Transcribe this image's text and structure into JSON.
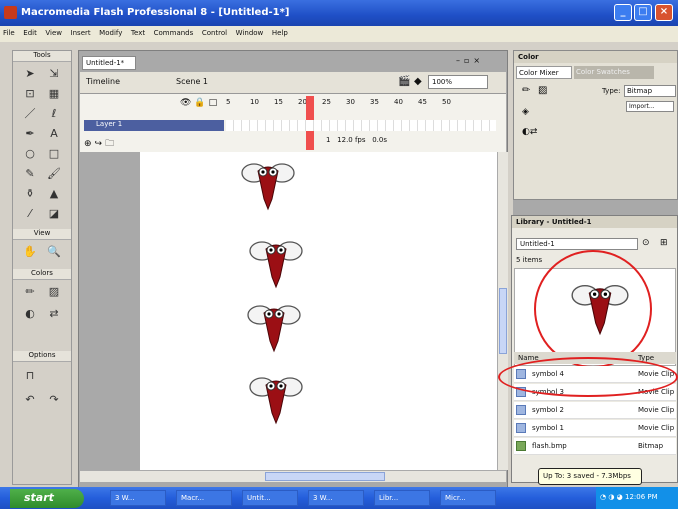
{
  "window": {
    "title": "Macromedia Flash Professional 8 - [Untitled-1*]"
  },
  "menu": [
    "File",
    "Edit",
    "View",
    "Insert",
    "Modify",
    "Text",
    "Commands",
    "Control",
    "Window",
    "Help"
  ],
  "tools": {
    "header": "Tools",
    "view_header": "View",
    "colors_header": "Colors",
    "options_header": "Options"
  },
  "document": {
    "tab": "Untitled-1*",
    "timeline_label": "Timeline",
    "scene_label": "Scene 1",
    "zoom_value": "100%",
    "frame_numbers": [
      "5",
      "10",
      "15",
      "20",
      "25",
      "30",
      "35",
      "40",
      "45",
      "50"
    ],
    "layer_name": "Layer 1",
    "current_frame": "1",
    "fps": "12.0 fps",
    "elapsed": "0.0s"
  },
  "color_panel": {
    "header": "Color",
    "tab_mixer": "Color Mixer",
    "tab_swatches": "Color Swatches",
    "type_label": "Type:",
    "type_value": "Bitmap",
    "import_label": "Import..."
  },
  "library": {
    "header": "Library - Untitled-1",
    "doc_select": "Untitled-1",
    "item_count": "5 items",
    "col_name": "Name",
    "col_type": "Type",
    "items": [
      {
        "name": "symbol 4",
        "type": "Movie Clip"
      },
      {
        "name": "symbol 3",
        "type": "Movie Clip"
      },
      {
        "name": "symbol 2",
        "type": "Movie Clip"
      },
      {
        "name": "symbol 1",
        "type": "Movie Clip"
      },
      {
        "name": "flash.bmp",
        "type": "Bitmap"
      }
    ]
  },
  "tooltip": "Up To: 3 saved - 7.3Mbps",
  "taskbar": {
    "start": "start",
    "items": [
      "3 W...",
      "Macr...",
      "Untit...",
      "3 W...",
      "Libr...",
      "Micr..."
    ],
    "clock": "12:06 PM"
  }
}
